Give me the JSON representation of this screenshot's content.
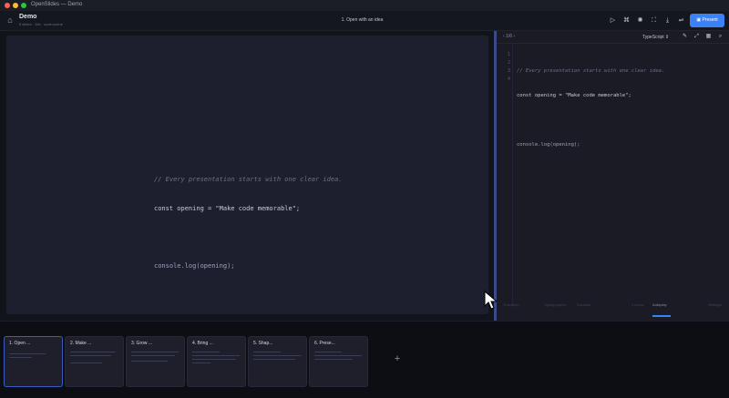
{
  "window": {
    "title": "OpenSlides — Demo"
  },
  "header": {
    "doc_name": "Demo",
    "doc_meta": "5 slides · 16s · code-scene",
    "slide_title": "1. Open with an idea",
    "present_label": "Present"
  },
  "stage": {
    "code_lines": [
      {
        "text": "// Every presentation starts with one clear idea.",
        "kind": "comment"
      },
      {
        "text": "const opening = \"Make code memorable\";",
        "kind": "code"
      },
      {
        "text": "",
        "kind": "blank"
      },
      {
        "text": "console.log(opening);",
        "kind": "code"
      }
    ]
  },
  "editor": {
    "nav_label": "1/6",
    "language": "TypeScript",
    "line_numbers": [
      "1",
      "2",
      "3",
      "4"
    ],
    "code_lines": [
      "// Every presentation starts with one clear idea.",
      "const opening = \"Make code memorable\";",
      "",
      "console.log(opening);"
    ],
    "footer": {
      "left": "Transition",
      "mid1": "Typing speed",
      "mid2": "Duration",
      "right1": "1 scene",
      "right2": "Autoplay",
      "right3": "Settings"
    }
  },
  "slides": [
    {
      "label": "1. Open ...",
      "active": true
    },
    {
      "label": "2. Make ...",
      "active": false
    },
    {
      "label": "3. Grow ...",
      "active": false
    },
    {
      "label": "4. Bring ...",
      "active": false
    },
    {
      "label": "5. Shap...",
      "active": false
    },
    {
      "label": "6. Prese...",
      "active": false
    }
  ],
  "icons": {
    "home": "home-icon",
    "play": "play-icon",
    "command": "command-icon",
    "theme": "sun-icon",
    "focus": "focus-icon",
    "export": "download-icon",
    "settings": "sliders-icon",
    "present": "present-icon",
    "add": "plus-icon"
  },
  "colors": {
    "accent": "#3b82f6",
    "stage_bg": "#1e1f2e",
    "editor_bg": "#1a1b24"
  }
}
